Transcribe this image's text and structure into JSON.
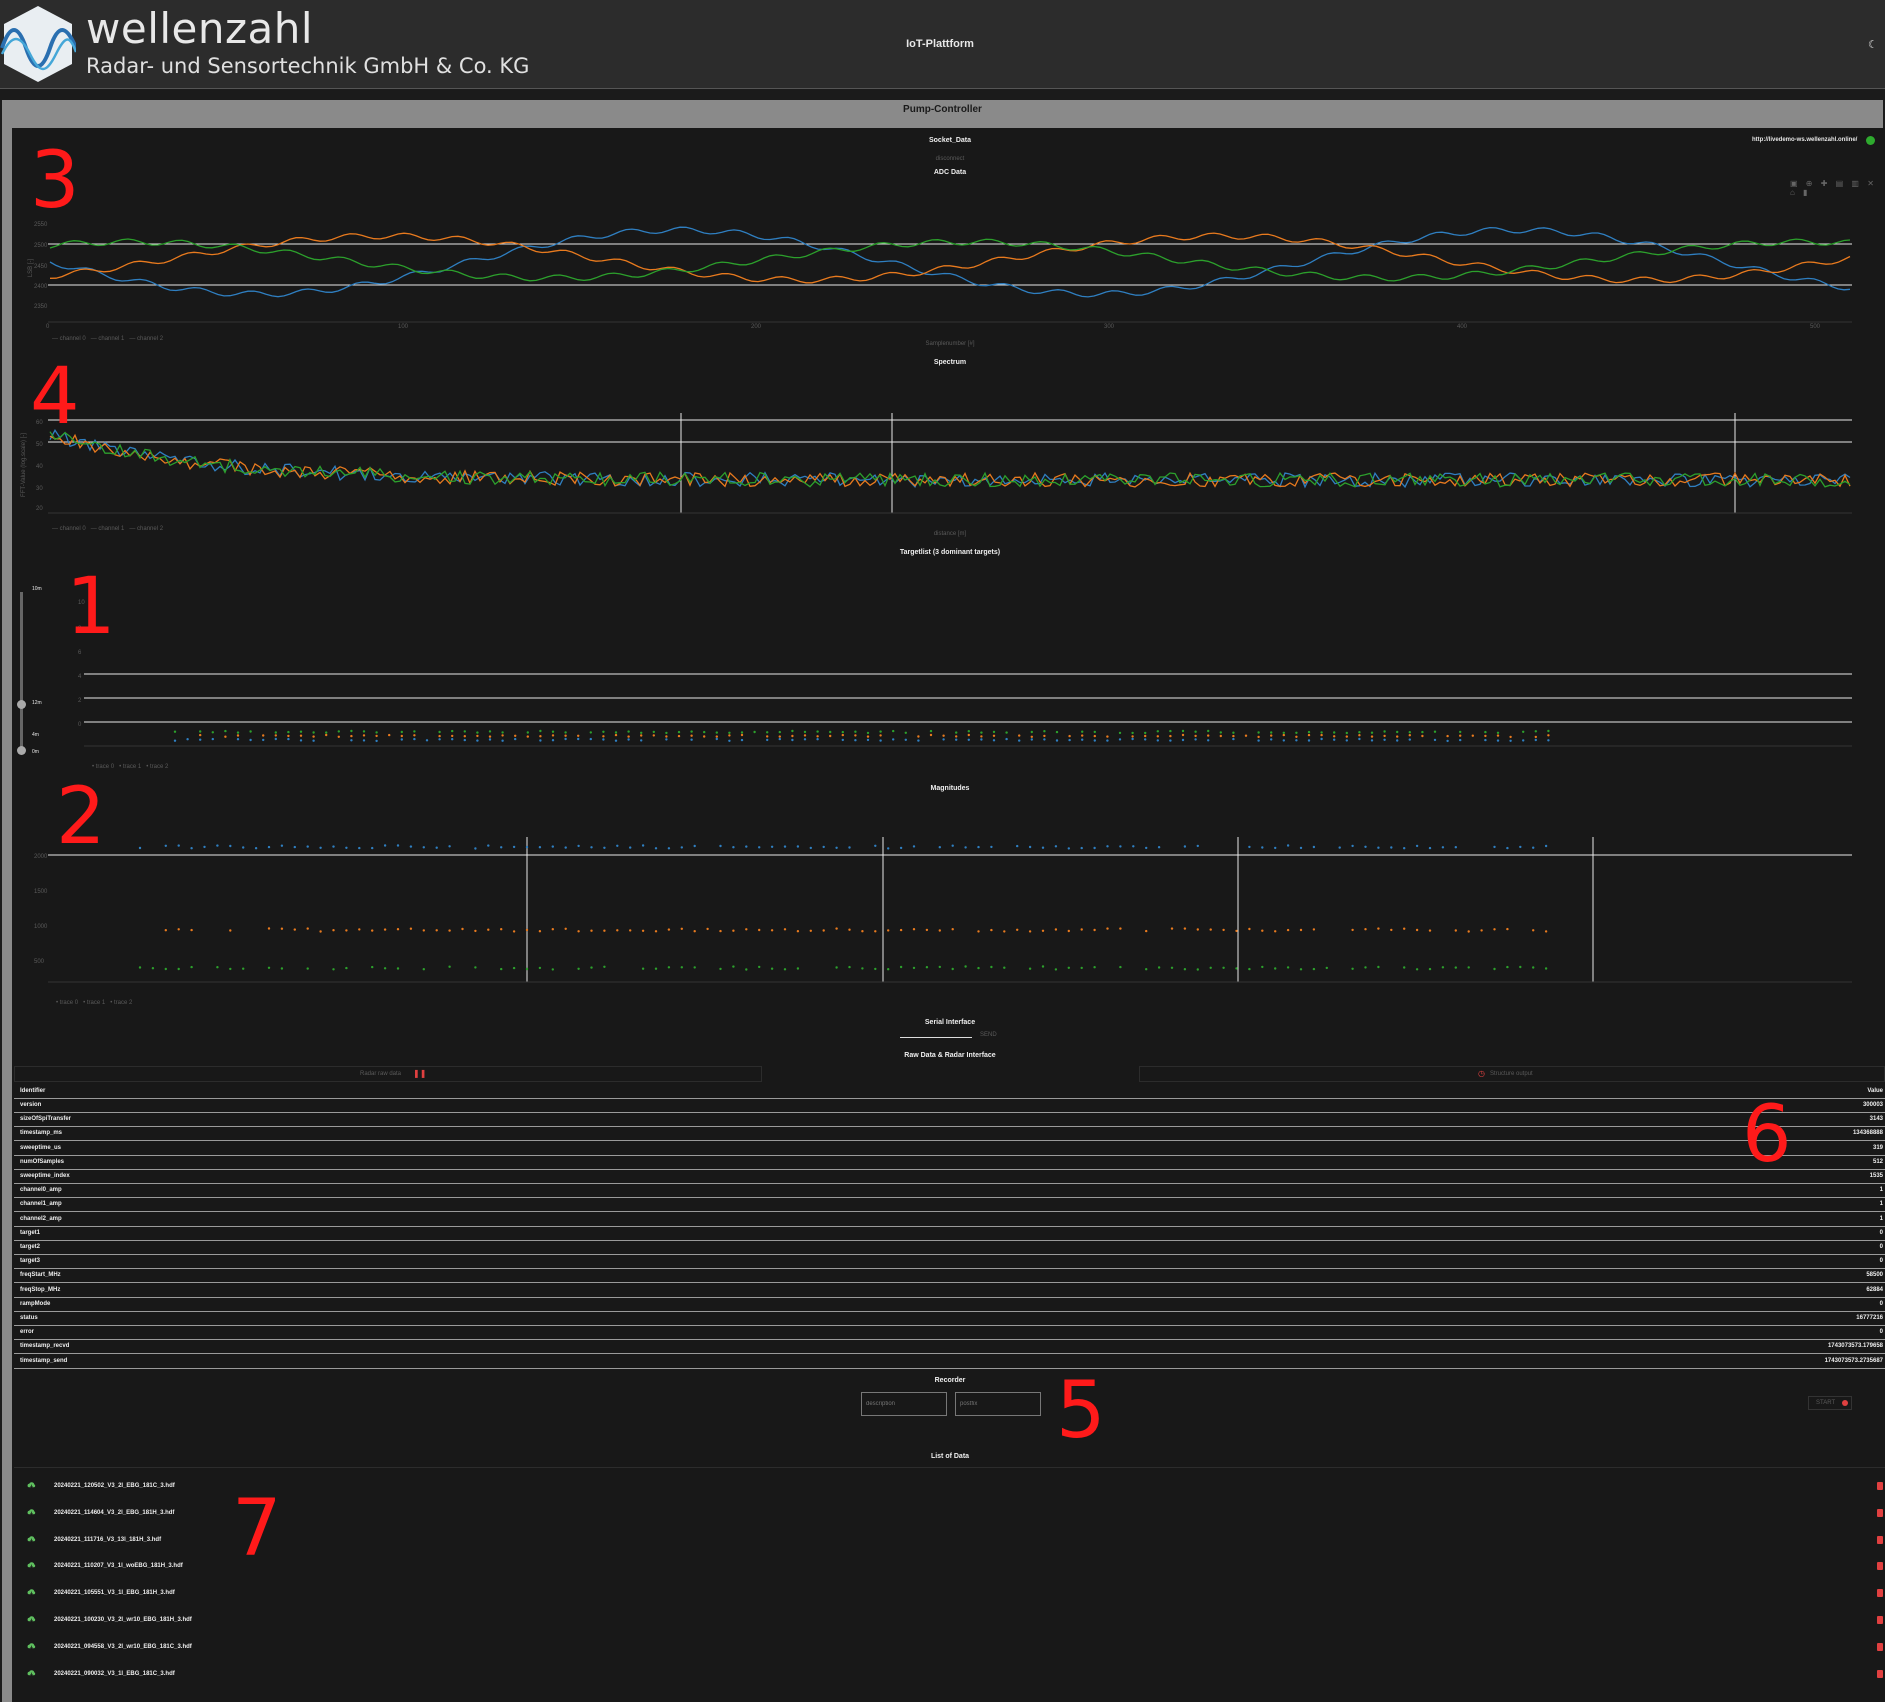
{
  "header": {
    "brand_name": "wellenzahl",
    "brand_sub": "Radar- und Sensortechnik GmbH & Co. KG",
    "platform_title": "IoT-Plattform",
    "theme_icon": "moon-icon"
  },
  "card": {
    "title": "Pump-Controller",
    "socket_title": "Socket_Data",
    "socket_url": "http://livedemo-ws.wellenzahl.online/",
    "status_color": "#2eaa2e",
    "disconnect_label": "disconnect"
  },
  "plots": {
    "adc": {
      "title": "ADC Data",
      "xlabel": "Samplenumber [#]",
      "ylabel": "LSB [-]"
    },
    "spectrum": {
      "title": "Spectrum",
      "xlabel": "distance [m]",
      "ylabel": "FFT-Value (log.scale) [-]"
    },
    "targetlist": {
      "title": "Targetlist (3 dominant targets)",
      "slider_labels": [
        "10m",
        "12m",
        "4m",
        "0m"
      ]
    },
    "magnitudes": {
      "title": "Magnitudes"
    }
  },
  "serial": {
    "title": "Serial Interface",
    "send_label": "SEND",
    "raw_title": "Raw Data & Radar Interface",
    "tab_left": "Radar raw data",
    "tab_right": "Structure output"
  },
  "table": {
    "header_key": "Identifier",
    "header_value": "Value",
    "rows": [
      {
        "k": "version",
        "v": "300003"
      },
      {
        "k": "sizeOfSpiTransfer",
        "v": "3143"
      },
      {
        "k": "timestamp_ms",
        "v": "134368888"
      },
      {
        "k": "sweeptime_us",
        "v": "319"
      },
      {
        "k": "numOfSamples",
        "v": "512"
      },
      {
        "k": "sweeptime_index",
        "v": "1535"
      },
      {
        "k": "channel0_amp",
        "v": "1"
      },
      {
        "k": "channel1_amp",
        "v": "1"
      },
      {
        "k": "channel2_amp",
        "v": "1"
      },
      {
        "k": "target1",
        "v": "0"
      },
      {
        "k": "target2",
        "v": "0"
      },
      {
        "k": "target3",
        "v": "0"
      },
      {
        "k": "freqStart_MHz",
        "v": "58500"
      },
      {
        "k": "freqStop_MHz",
        "v": "62884"
      },
      {
        "k": "rampMode",
        "v": "0"
      },
      {
        "k": "status",
        "v": "16777216"
      },
      {
        "k": "error",
        "v": "0"
      },
      {
        "k": "timestamp_recvd",
        "v": "1743073573.179658"
      },
      {
        "k": "timestamp_send",
        "v": "1743073573.2735687"
      }
    ]
  },
  "recorder": {
    "title": "Recorder",
    "description_placeholder": "description",
    "postfix_placeholder": "postfix",
    "start_label": "START"
  },
  "files": {
    "title": "List of Data",
    "items": [
      "20240221_120502_V3_2l_EBG_181C_3.hdf",
      "20240221_114604_V3_2l_EBG_181H_3.hdf",
      "20240221_111716_V3_13l_181H_3.hdf",
      "20240221_110207_V3_1l_woEBG_181H_3.hdf",
      "20240221_105551_V3_1l_EBG_181H_3.hdf",
      "20240221_100230_V3_2l_wr10_EBG_181H_3.hdf",
      "20240221_094558_V3_2l_wr10_EBG_181C_3.hdf",
      "20240221_090032_V3_1l_EBG_181C_3.hdf"
    ]
  },
  "annotations": [
    "3",
    "4",
    "1",
    "2",
    "6",
    "5",
    "7"
  ],
  "colors": {
    "ch0": "#2f7fc1",
    "ch1": "#e87a1e",
    "ch2": "#2ca02c",
    "delete": "#e04040",
    "annotation": "#ff1a1a"
  }
}
